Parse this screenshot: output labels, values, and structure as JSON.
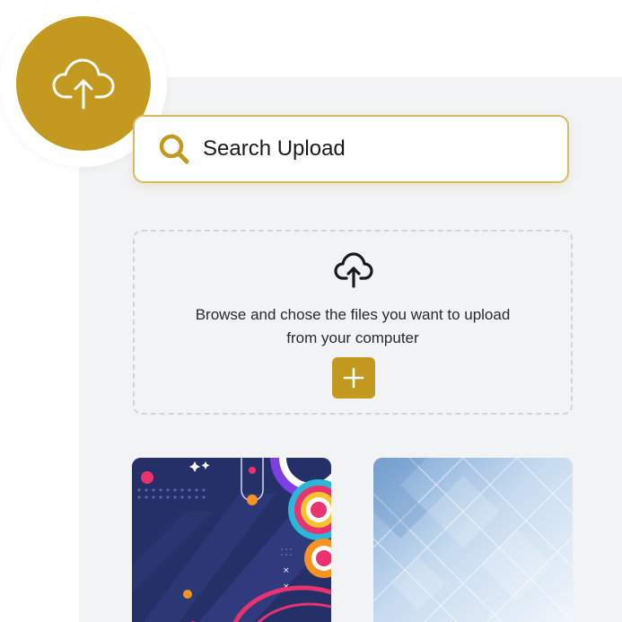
{
  "badge": {
    "icon": "cloud-upload-icon",
    "color": "#c39a1f"
  },
  "search": {
    "icon": "search-icon",
    "placeholder": "Search Upload",
    "value": "",
    "border_color": "#d9b963"
  },
  "dropzone": {
    "icon": "cloud-upload-icon",
    "line1": "Browse and chose the files you want to upload",
    "line2": "from your computer",
    "add_button_icon": "plus-icon",
    "accent": "#c39a1f"
  },
  "thumbnails": [
    {
      "name": "abstract-geometric-thumbnail",
      "theme": "dark navy with colorful circles"
    },
    {
      "name": "blue-light-thumbnail",
      "theme": "light blue diagonal pattern"
    }
  ]
}
